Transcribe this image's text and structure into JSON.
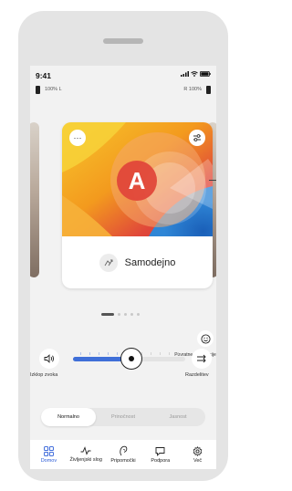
{
  "status_bar": {
    "time": "9:41",
    "icons": [
      "signal-icon",
      "wifi-icon",
      "battery-icon"
    ]
  },
  "battery": {
    "left": "100% L",
    "right": "R  100%"
  },
  "program": {
    "letter": "A",
    "label": "Samodejno",
    "more_symbol": "···",
    "pages": {
      "current": 1,
      "total": 5
    }
  },
  "feedback": {
    "label": "Povratne informacije"
  },
  "volume": {
    "mute_label": "Izklop zvoka",
    "split_label": "Razdelitev",
    "level": 0.52
  },
  "segments": {
    "items": [
      "Normalno",
      "Prinočnost",
      "Jasnost"
    ],
    "selected": 0
  },
  "tabs": {
    "items": [
      {
        "label": "Domov",
        "icon": "home-grid-icon"
      },
      {
        "label": "Življenjski slog",
        "icon": "activity-icon"
      },
      {
        "label": "Pripomočki",
        "icon": "hearing-aid-icon"
      },
      {
        "label": "Podpora",
        "icon": "chat-icon"
      },
      {
        "label": "Več",
        "icon": "gear-icon"
      }
    ],
    "active": 0
  },
  "colors": {
    "accent": "#2a5bd7",
    "slider": "#3f6fd8",
    "art_orange": "#f39a1e",
    "art_red": "#e0473a",
    "art_blue": "#1f6fc9",
    "art_yellow": "#f7c62c"
  }
}
